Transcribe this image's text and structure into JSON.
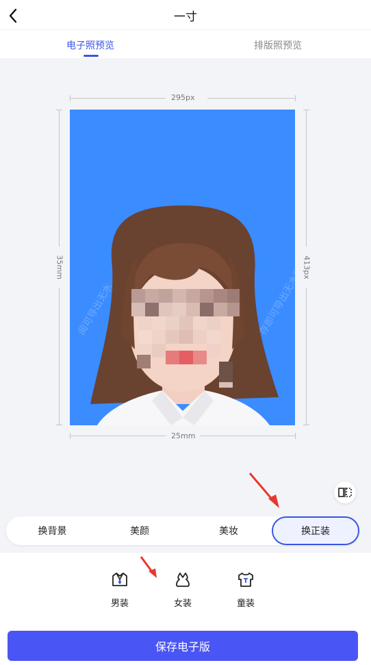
{
  "header": {
    "title": "一寸"
  },
  "tabs": [
    {
      "label": "电子照预览",
      "active": true
    },
    {
      "label": "排版照预览",
      "active": false
    }
  ],
  "dimensions": {
    "top_px": "295px",
    "right_px": "413px",
    "left_mm": "35mm",
    "bottom_mm": "25mm"
  },
  "photo": {
    "background_color": "#3b8cff"
  },
  "tools": [
    {
      "label": "换背景",
      "active": false
    },
    {
      "label": "美颜",
      "active": false
    },
    {
      "label": "美妆",
      "active": false
    },
    {
      "label": "换正装",
      "active": true
    }
  ],
  "outfits": [
    {
      "label": "男装",
      "icon": "mens-suit-icon"
    },
    {
      "label": "女装",
      "icon": "womens-suit-icon"
    },
    {
      "label": "童装",
      "icon": "kids-suit-icon"
    }
  ],
  "save_button": {
    "label": "保存电子版"
  },
  "colors": {
    "accent": "#3b55e6",
    "save": "#4a55f5",
    "annotation_arrow": "#e8372c"
  }
}
